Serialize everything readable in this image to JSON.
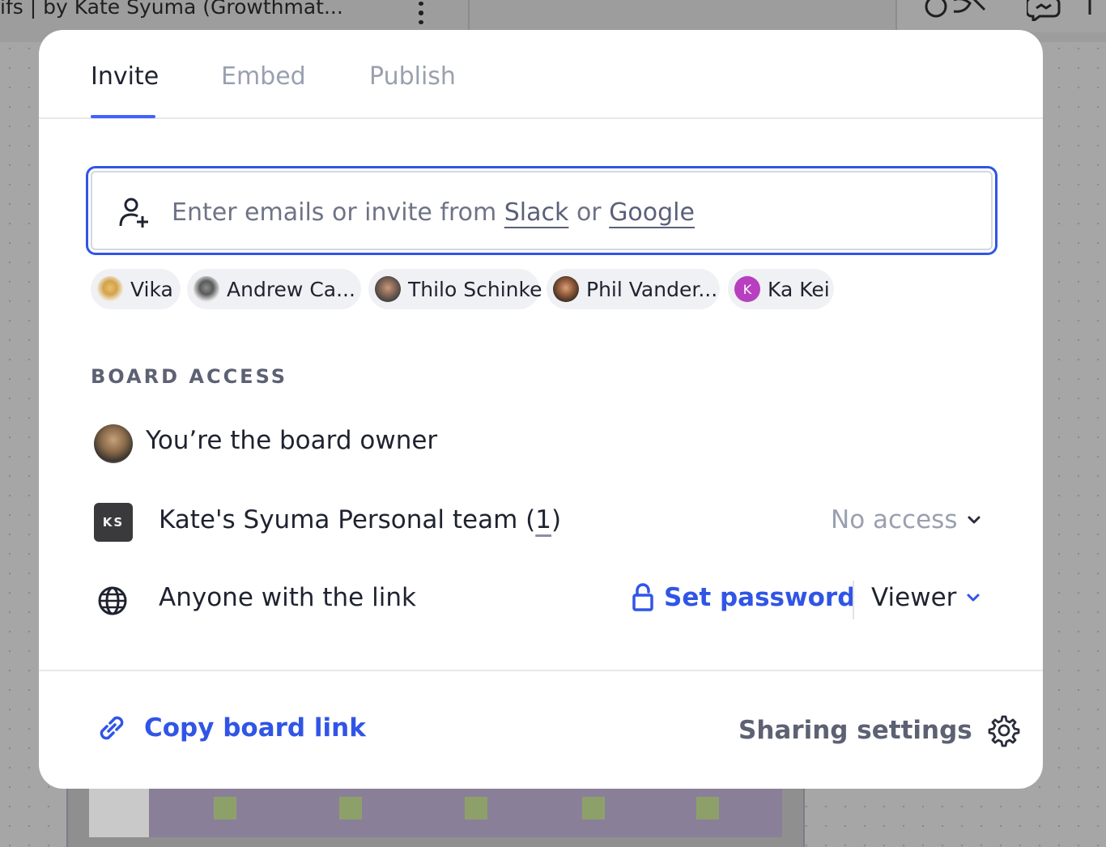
{
  "background": {
    "board_title": "ifs | by Kate Syuma (Growthmat..."
  },
  "modal": {
    "tabs": [
      {
        "label": "Invite",
        "active": true
      },
      {
        "label": "Embed",
        "active": false
      },
      {
        "label": "Publish",
        "active": false
      }
    ],
    "invite": {
      "placeholder_prefix": "Enter emails or invite from",
      "slack_label": "Slack",
      "or_label": "or",
      "google_label": "Google",
      "icon": "add-person-icon"
    },
    "suggestions": [
      {
        "name": "Vika",
        "avatar": "photo"
      },
      {
        "name": "Andrew Ca...",
        "avatar": "photo"
      },
      {
        "name": "Thilo Schinke",
        "avatar": "photo"
      },
      {
        "name": "Phil Vander...",
        "avatar": "photo"
      },
      {
        "name": "Ka Kei",
        "avatar": "initial",
        "initial": "K",
        "color": "#b83fbf"
      }
    ],
    "board_access": {
      "title": "BOARD ACCESS",
      "owner_text": "You’re the board owner",
      "team": {
        "initials": "KS",
        "name": "Kate's Syuma Personal team (",
        "count": "1",
        "close": ")",
        "access": "No access"
      },
      "link": {
        "label": "Anyone with the link",
        "set_password": "Set password",
        "role": "Viewer"
      }
    },
    "footer": {
      "copy_link": "Copy board link",
      "sharing_settings": "Sharing settings"
    }
  },
  "colors": {
    "accent": "#4262ff",
    "link_blue": "#3055e6",
    "muted": "#9aa0b0",
    "text": "#1f2330"
  }
}
